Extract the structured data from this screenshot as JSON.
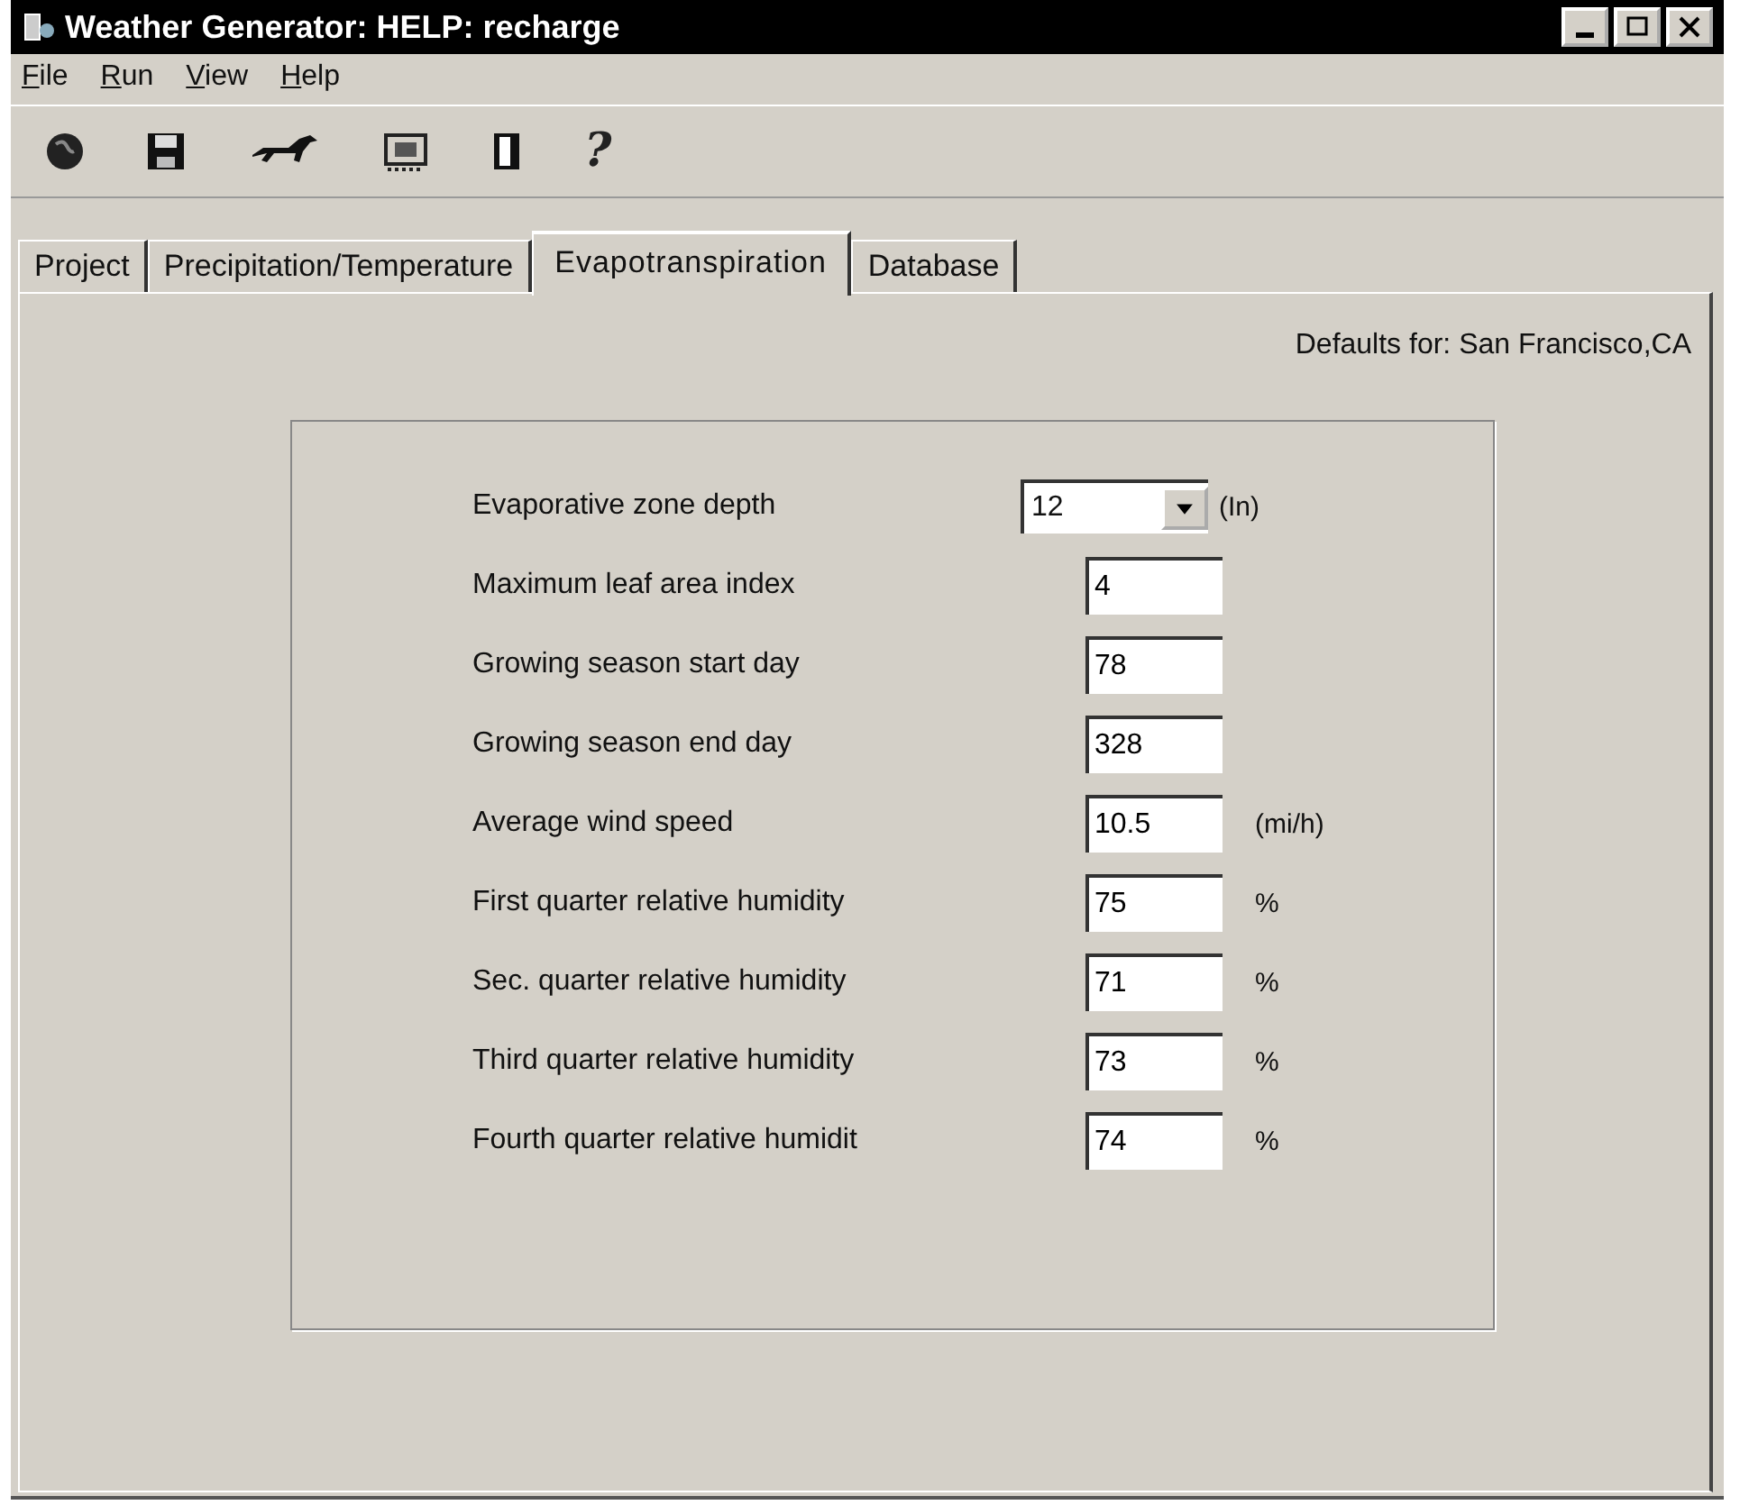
{
  "window": {
    "title": "Weather Generator: HELP: recharge"
  },
  "menu": [
    "File",
    "Run",
    "View",
    "Help"
  ],
  "toolbar": [
    {
      "kind": "globe"
    },
    {
      "kind": "save"
    },
    {
      "kind": "horse"
    },
    {
      "kind": "film"
    },
    {
      "kind": "door"
    },
    {
      "kind": "help",
      "label": "?"
    }
  ],
  "tabs": [
    {
      "label": "Project",
      "selected": false
    },
    {
      "label": "Precipitation/Temperature",
      "selected": false
    },
    {
      "label": "Evapotranspiration",
      "selected": true
    },
    {
      "label": "Database",
      "selected": false
    }
  ],
  "defaults_text": "Defaults for: San Francisco,CA",
  "fields": [
    {
      "label": "Evaporative zone depth",
      "kind": "dropdown",
      "value": "12",
      "unit": "(In)"
    },
    {
      "label": "Maximum leaf area index",
      "kind": "text",
      "value": "4"
    },
    {
      "label": "Growing season start day",
      "kind": "text",
      "value": "78"
    },
    {
      "label": "Growing season end day",
      "kind": "text",
      "value": "328"
    },
    {
      "label": "Average wind speed",
      "kind": "text",
      "value": "10.5",
      "unit": "(mi/h)"
    },
    {
      "label": "First quarter relative humidity",
      "kind": "text",
      "value": "75",
      "unit": "%"
    },
    {
      "label": "Sec. quarter relative humidity",
      "kind": "text",
      "value": "71",
      "unit": "%"
    },
    {
      "label": "Third quarter relative humidity",
      "kind": "text",
      "value": "73",
      "unit": "%"
    },
    {
      "label": "Fourth quarter relative humidit",
      "kind": "text",
      "value": "74",
      "unit": "%"
    }
  ]
}
